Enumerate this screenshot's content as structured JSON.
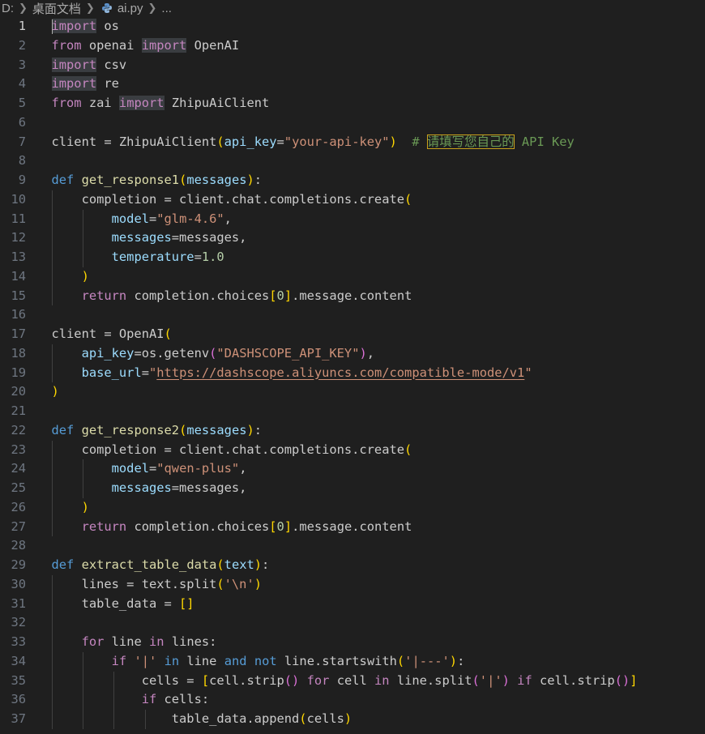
{
  "breadcrumb": {
    "drive": "D:",
    "folder": "桌面文档",
    "file": "ai.py",
    "more": "..."
  },
  "editor": {
    "language": "python",
    "current_line": 1,
    "lines": [
      {
        "n": "1",
        "t": [
          [
            "import",
            "kw-hl"
          ],
          [
            " os",
            "plain"
          ]
        ]
      },
      {
        "n": "2",
        "t": [
          [
            "from",
            "kw"
          ],
          [
            " openai ",
            "plain"
          ],
          [
            "import",
            "kw-hl"
          ],
          [
            " OpenAI",
            "plain"
          ]
        ]
      },
      {
        "n": "3",
        "t": [
          [
            "import",
            "kw-hl"
          ],
          [
            " csv",
            "plain"
          ]
        ]
      },
      {
        "n": "4",
        "t": [
          [
            "import",
            "kw-hl"
          ],
          [
            " re",
            "plain"
          ]
        ]
      },
      {
        "n": "5",
        "t": [
          [
            "from",
            "kw"
          ],
          [
            " zai ",
            "plain"
          ],
          [
            "import",
            "kw-hl"
          ],
          [
            " ZhipuAiClient",
            "plain"
          ]
        ]
      },
      {
        "n": "6",
        "t": []
      },
      {
        "n": "7",
        "t": [
          [
            "client = ZhipuAiClient",
            "plain"
          ],
          [
            "(",
            "p1"
          ],
          [
            "api_key",
            "var"
          ],
          [
            "=",
            "plain"
          ],
          [
            "\"your-api-key\"",
            "str"
          ],
          [
            ")",
            "p1"
          ],
          [
            "  # ",
            "cmt"
          ],
          [
            "请填写您自己的",
            "cmt boxed"
          ],
          [
            " API Key",
            "cmt"
          ]
        ]
      },
      {
        "n": "8",
        "t": []
      },
      {
        "n": "9",
        "t": [
          [
            "def",
            "kw-blue"
          ],
          [
            " ",
            "plain"
          ],
          [
            "get_response1",
            "fn"
          ],
          [
            "(",
            "p1"
          ],
          [
            "messages",
            "var"
          ],
          [
            ")",
            "p1"
          ],
          [
            ":",
            "plain"
          ]
        ]
      },
      {
        "n": "10",
        "t": [
          [
            "    completion = client.chat.completions.create",
            "plain"
          ],
          [
            "(",
            "p1"
          ]
        ]
      },
      {
        "n": "11",
        "t": [
          [
            "        ",
            "plain"
          ],
          [
            "model",
            "var"
          ],
          [
            "=",
            "plain"
          ],
          [
            "\"glm-4.6\"",
            "str"
          ],
          [
            ",",
            "plain"
          ]
        ]
      },
      {
        "n": "12",
        "t": [
          [
            "        ",
            "plain"
          ],
          [
            "messages",
            "var"
          ],
          [
            "=messages,",
            "plain"
          ]
        ]
      },
      {
        "n": "13",
        "t": [
          [
            "        ",
            "plain"
          ],
          [
            "temperature",
            "var"
          ],
          [
            "=",
            "plain"
          ],
          [
            "1.0",
            "num"
          ]
        ]
      },
      {
        "n": "14",
        "t": [
          [
            "    ",
            "plain"
          ],
          [
            ")",
            "p1"
          ]
        ]
      },
      {
        "n": "15",
        "t": [
          [
            "    ",
            "plain"
          ],
          [
            "return",
            "kw"
          ],
          [
            " completion.choices",
            "plain"
          ],
          [
            "[",
            "p1"
          ],
          [
            "0",
            "num"
          ],
          [
            "]",
            "p1"
          ],
          [
            ".message.content",
            "plain"
          ]
        ]
      },
      {
        "n": "16",
        "t": []
      },
      {
        "n": "17",
        "t": [
          [
            "client = OpenAI",
            "plain"
          ],
          [
            "(",
            "p1"
          ]
        ]
      },
      {
        "n": "18",
        "t": [
          [
            "    ",
            "plain"
          ],
          [
            "api_key",
            "var"
          ],
          [
            "=os.getenv",
            "plain"
          ],
          [
            "(",
            "p2"
          ],
          [
            "\"DASHSCOPE_API_KEY\"",
            "str"
          ],
          [
            ")",
            "p2"
          ],
          [
            ",",
            "plain"
          ]
        ]
      },
      {
        "n": "19",
        "t": [
          [
            "    ",
            "plain"
          ],
          [
            "base_url",
            "var"
          ],
          [
            "=",
            "plain"
          ],
          [
            "\"",
            "str"
          ],
          [
            "https://dashscope.aliyuncs.com/compatible-mode/v1",
            "link"
          ],
          [
            "\"",
            "str"
          ]
        ]
      },
      {
        "n": "20",
        "t": [
          [
            ")",
            "p1"
          ]
        ]
      },
      {
        "n": "21",
        "t": []
      },
      {
        "n": "22",
        "t": [
          [
            "def",
            "kw-blue"
          ],
          [
            " ",
            "plain"
          ],
          [
            "get_response2",
            "fn"
          ],
          [
            "(",
            "p1"
          ],
          [
            "messages",
            "var"
          ],
          [
            ")",
            "p1"
          ],
          [
            ":",
            "plain"
          ]
        ]
      },
      {
        "n": "23",
        "t": [
          [
            "    completion = client.chat.completions.create",
            "plain"
          ],
          [
            "(",
            "p1"
          ]
        ]
      },
      {
        "n": "24",
        "t": [
          [
            "        ",
            "plain"
          ],
          [
            "model",
            "var"
          ],
          [
            "=",
            "plain"
          ],
          [
            "\"qwen-plus\"",
            "str"
          ],
          [
            ",",
            "plain"
          ]
        ]
      },
      {
        "n": "25",
        "t": [
          [
            "        ",
            "plain"
          ],
          [
            "messages",
            "var"
          ],
          [
            "=messages,",
            "plain"
          ]
        ]
      },
      {
        "n": "26",
        "t": [
          [
            "    ",
            "plain"
          ],
          [
            ")",
            "p1"
          ]
        ]
      },
      {
        "n": "27",
        "t": [
          [
            "    ",
            "plain"
          ],
          [
            "return",
            "kw"
          ],
          [
            " completion.choices",
            "plain"
          ],
          [
            "[",
            "p1"
          ],
          [
            "0",
            "num"
          ],
          [
            "]",
            "p1"
          ],
          [
            ".message.content",
            "plain"
          ]
        ]
      },
      {
        "n": "28",
        "t": []
      },
      {
        "n": "29",
        "t": [
          [
            "def",
            "kw-blue"
          ],
          [
            " ",
            "plain"
          ],
          [
            "extract_table_data",
            "fn"
          ],
          [
            "(",
            "p1"
          ],
          [
            "text",
            "var"
          ],
          [
            ")",
            "p1"
          ],
          [
            ":",
            "plain"
          ]
        ]
      },
      {
        "n": "30",
        "t": [
          [
            "    lines = text.split",
            "plain"
          ],
          [
            "(",
            "p1"
          ],
          [
            "'\\n'",
            "str"
          ],
          [
            ")",
            "p1"
          ]
        ]
      },
      {
        "n": "31",
        "t": [
          [
            "    table_data = ",
            "plain"
          ],
          [
            "[]",
            "p1"
          ]
        ]
      },
      {
        "n": "32",
        "t": []
      },
      {
        "n": "33",
        "t": [
          [
            "    ",
            "plain"
          ],
          [
            "for",
            "kw"
          ],
          [
            " line ",
            "plain"
          ],
          [
            "in",
            "kw"
          ],
          [
            " lines:",
            "plain"
          ]
        ]
      },
      {
        "n": "34",
        "t": [
          [
            "        ",
            "plain"
          ],
          [
            "if",
            "kw"
          ],
          [
            " ",
            "plain"
          ],
          [
            "'|'",
            "str"
          ],
          [
            " ",
            "plain"
          ],
          [
            "in",
            "kw-blue"
          ],
          [
            " line ",
            "plain"
          ],
          [
            "and",
            "kw-blue"
          ],
          [
            " ",
            "plain"
          ],
          [
            "not",
            "kw-blue"
          ],
          [
            " line.startswith",
            "plain"
          ],
          [
            "(",
            "p1"
          ],
          [
            "'|---'",
            "str"
          ],
          [
            ")",
            "p1"
          ],
          [
            ":",
            "plain"
          ]
        ]
      },
      {
        "n": "35",
        "t": [
          [
            "            cells = ",
            "plain"
          ],
          [
            "[",
            "p1"
          ],
          [
            "cell.strip",
            "plain"
          ],
          [
            "()",
            "p2"
          ],
          [
            " ",
            "plain"
          ],
          [
            "for",
            "kw"
          ],
          [
            " cell ",
            "plain"
          ],
          [
            "in",
            "kw"
          ],
          [
            " line.split",
            "plain"
          ],
          [
            "(",
            "p2"
          ],
          [
            "'|'",
            "str"
          ],
          [
            ")",
            "p2"
          ],
          [
            " ",
            "plain"
          ],
          [
            "if",
            "kw"
          ],
          [
            " cell.strip",
            "plain"
          ],
          [
            "()",
            "p2"
          ],
          [
            "]",
            "p1"
          ]
        ]
      },
      {
        "n": "36",
        "t": [
          [
            "            ",
            "plain"
          ],
          [
            "if",
            "kw"
          ],
          [
            " cells:",
            "plain"
          ]
        ]
      },
      {
        "n": "37",
        "t": [
          [
            "                table_data.append",
            "plain"
          ],
          [
            "(",
            "p1"
          ],
          [
            "cells",
            "plain"
          ],
          [
            ")",
            "p1"
          ]
        ]
      }
    ]
  }
}
